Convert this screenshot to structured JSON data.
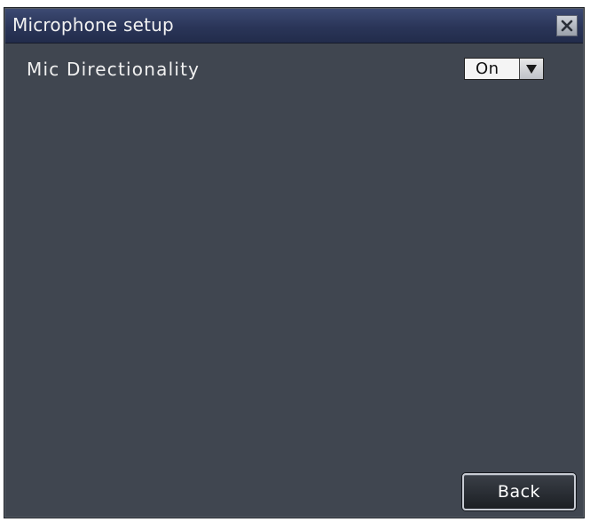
{
  "window": {
    "title": "Microphone setup",
    "close_icon": "close-icon"
  },
  "settings": {
    "mic_directionality": {
      "label": "Mic Directionality",
      "value": "On",
      "arrow_icon": "dropdown-arrow-icon"
    }
  },
  "footer": {
    "back_label": "Back"
  }
}
